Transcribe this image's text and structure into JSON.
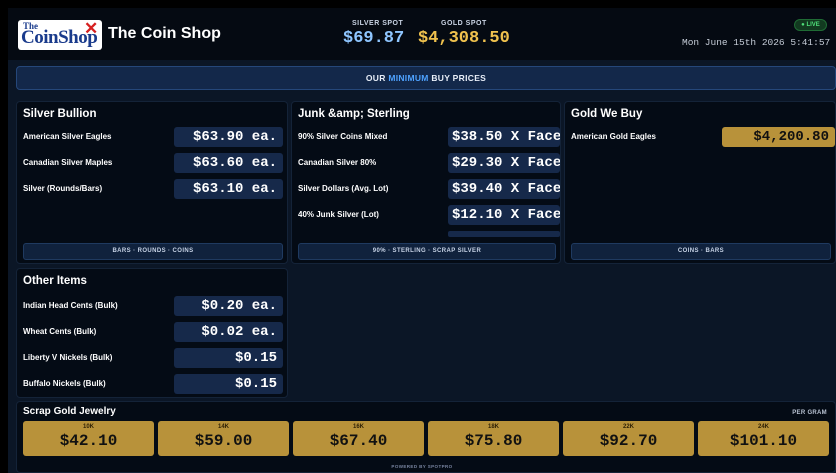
{
  "header": {
    "logo_the": "The",
    "logo_main": "CoinShop",
    "shop_name": "The Coin Shop",
    "silver_spot_label": "SILVER SPOT",
    "silver_spot_value": "$69.87",
    "gold_spot_label": "GOLD SPOT",
    "gold_spot_value": "$4,308.50",
    "live_label": "● LIVE",
    "clock": "Mon June 15th 2026 5:41:57"
  },
  "banner": {
    "prefix": "OUR",
    "highlight": "MINIMUM",
    "suffix": "BUY PRICES"
  },
  "silver_bullion": {
    "title": "Silver Bullion",
    "rows": [
      {
        "label": "American Silver Eagles",
        "price": "$63.90 ea."
      },
      {
        "label": "Canadian Silver Maples",
        "price": "$63.60 ea."
      },
      {
        "label": "Silver (Rounds/Bars)",
        "price": "$63.10 ea."
      }
    ],
    "footer": "BARS · ROUNDS · COINS"
  },
  "junk_sterling": {
    "title": "Junk &amp; Sterling",
    "rows": [
      {
        "label": "90% Silver Coins Mixed",
        "price": "$38.50 X Face"
      },
      {
        "label": "Canadian Silver 80%",
        "price": "$29.30 X Face"
      },
      {
        "label": "Silver Dollars (Avg. Lot)",
        "price": "$39.40 X Face"
      },
      {
        "label": "40% Junk Silver (Lot)",
        "price": "$12.10 X Face"
      }
    ],
    "footer": "90% · STERLING · SCRAP SILVER"
  },
  "gold_we_buy": {
    "title": "Gold We Buy",
    "rows": [
      {
        "label": "American Gold Eagles",
        "price": "$4,200.80"
      }
    ],
    "footer": "COINS · BARS"
  },
  "other_items": {
    "title": "Other Items",
    "rows": [
      {
        "label": "Indian Head Cents (Bulk)",
        "price": "$0.20 ea."
      },
      {
        "label": "Wheat Cents (Bulk)",
        "price": "$0.02 ea."
      },
      {
        "label": "Liberty V Nickels (Bulk)",
        "price": "$0.15"
      },
      {
        "label": "Buffalo Nickels (Bulk)",
        "price": "$0.15"
      }
    ]
  },
  "scrap_gold": {
    "title": "Scrap Gold Jewelry",
    "unit_label": "PER GRAM",
    "karats": [
      {
        "label": "10K",
        "price": "$42.10"
      },
      {
        "label": "14K",
        "price": "$59.00"
      },
      {
        "label": "16K",
        "price": "$67.40"
      },
      {
        "label": "18K",
        "price": "$75.80"
      },
      {
        "label": "22K",
        "price": "$92.70"
      },
      {
        "label": "24K",
        "price": "$101.10"
      }
    ]
  },
  "footer": {
    "powered_by": "POWERED BY SPOTPRO"
  },
  "colors": {
    "background": "#0b1626",
    "panel": "#040b15",
    "price_box": "#16294a",
    "gold_accent": "#b8923a",
    "silver_spot": "#8fc6ff",
    "gold_spot": "#f0c24e",
    "highlight_blue": "#4ea2ff",
    "live_green": "#4fe07a"
  }
}
